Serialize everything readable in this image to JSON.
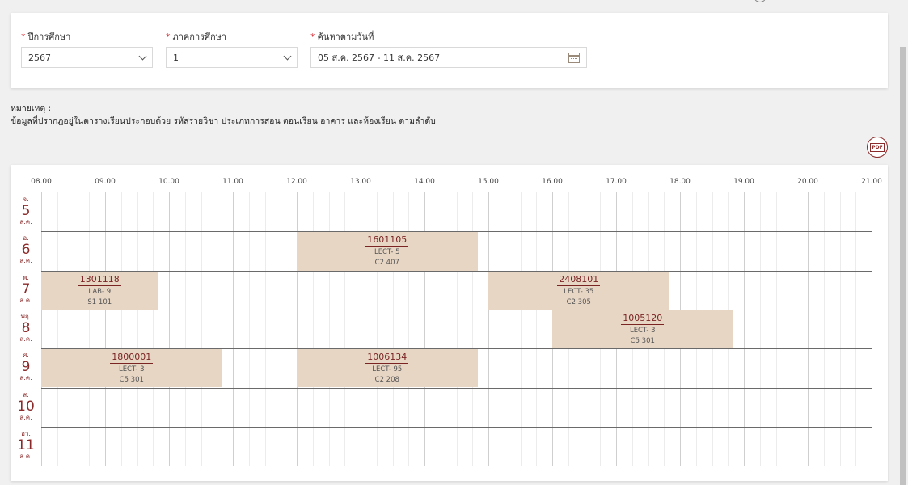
{
  "filters": {
    "year_label": "ปีการศึกษา",
    "year_value": "2567",
    "semester_label": "ภาคการศึกษา",
    "semester_value": "1",
    "date_label": "ค้นหาตามวันที่",
    "date_value": "05 ส.ค. 2567 - 11 ส.ค. 2567"
  },
  "note": {
    "title": "หมายเหตุ :",
    "text": "ข้อมูลที่ปรากฎอยู่ในตารางเรียนประกอบด้วย รหัสรายวิชา ประเภทการสอน ตอนเรียน อาคาร และห้องเรียน ตามลำดับ"
  },
  "pdf_label": "PDF",
  "hours": [
    "08.00",
    "09.00",
    "10.00",
    "11.00",
    "12.00",
    "13.00",
    "14.00",
    "15.00",
    "16.00",
    "17.00",
    "18.00",
    "19.00",
    "20.00",
    "21.00"
  ],
  "days": [
    {
      "abbr": "จ.",
      "num": "5",
      "month": "ส.ค."
    },
    {
      "abbr": "อ.",
      "num": "6",
      "month": "ส.ค."
    },
    {
      "abbr": "พ.",
      "num": "7",
      "month": "ส.ค."
    },
    {
      "abbr": "พฤ.",
      "num": "8",
      "month": "ส.ค."
    },
    {
      "abbr": "ศ.",
      "num": "9",
      "month": "ส.ค."
    },
    {
      "abbr": "ส.",
      "num": "10",
      "month": "ส.ค."
    },
    {
      "abbr": "อา.",
      "num": "11",
      "month": "ส.ค."
    }
  ],
  "classes": [
    {
      "code": "1601105",
      "type": "LECT- 5",
      "room": "C2 407",
      "day": 1,
      "start": 12.0,
      "end": 14.83
    },
    {
      "code": "1301118",
      "type": "LAB- 9",
      "room": "S1 101",
      "day": 2,
      "start": 8.0,
      "end": 9.83
    },
    {
      "code": "2408101",
      "type": "LECT- 35",
      "room": "C2 305",
      "day": 2,
      "start": 15.0,
      "end": 17.83
    },
    {
      "code": "1005120",
      "type": "LECT- 3",
      "room": "C5 301",
      "day": 3,
      "start": 16.0,
      "end": 18.83
    },
    {
      "code": "1800001",
      "type": "LECT- 3",
      "room": "C5 301",
      "day": 4,
      "start": 8.0,
      "end": 10.83
    },
    {
      "code": "1006134",
      "type": "LECT- 95",
      "room": "C2 208",
      "day": 4,
      "start": 12.0,
      "end": 14.83
    }
  ]
}
